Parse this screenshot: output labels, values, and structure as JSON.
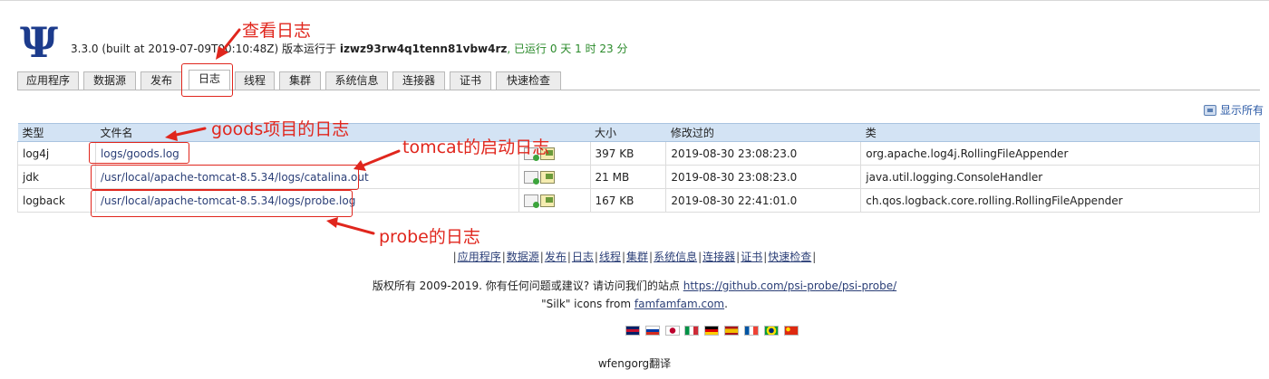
{
  "header": {
    "version": "3.3.0 (built at 2019-07-09T00:10:48Z) 版本运行于",
    "host": "izwz93rw4q1tenn81vbw4rz",
    "uptime": ", 已运行 0 天 1 时 23 分"
  },
  "tabs": [
    {
      "label": "应用程序"
    },
    {
      "label": "数据源"
    },
    {
      "label": "发布"
    },
    {
      "label": "日志"
    },
    {
      "label": "线程"
    },
    {
      "label": "集群"
    },
    {
      "label": "系统信息"
    },
    {
      "label": "连接器"
    },
    {
      "label": "证书"
    },
    {
      "label": "快速检查"
    }
  ],
  "show_all": "显示所有",
  "table": {
    "headers": {
      "type": "类型",
      "file": "文件名",
      "size": "大小",
      "modified": "修改过的",
      "class": "类"
    },
    "rows": [
      {
        "type": "log4j",
        "file": "logs/goods.log",
        "size": "397 KB",
        "modified": "2019-08-30 23:08:23.0",
        "class": "org.apache.log4j.RollingFileAppender"
      },
      {
        "type": "jdk",
        "file": "/usr/local/apache-tomcat-8.5.34/logs/catalina.out",
        "size": "21 MB",
        "modified": "2019-08-30 23:08:23.0",
        "class": "java.util.logging.ConsoleHandler"
      },
      {
        "type": "logback",
        "file": "/usr/local/apache-tomcat-8.5.34/logs/probe.log",
        "size": "167 KB",
        "modified": "2019-08-30 22:41:01.0",
        "class": "ch.qos.logback.core.rolling.RollingFileAppender"
      }
    ]
  },
  "footer": {
    "nav": [
      "应用程序",
      "数据源",
      "发布",
      "日志",
      "线程",
      "集群",
      "系统信息",
      "连接器",
      "证书",
      "快速检查"
    ],
    "copyright_prefix": "版权所有 2009-2019. 你有任何问题或建议? 请访问我们的站点",
    "copyright_link": "https://github.com/psi-probe/psi-probe/",
    "silk_prefix": "\"Silk\" icons from",
    "silk_link": "famfamfam.com",
    "silk_suffix": ".",
    "translator": "wfengorg翻译"
  },
  "annotations": {
    "view_log": "查看日志",
    "goods_log": "goods项目的日志",
    "tomcat_log": "tomcat的启动日志",
    "probe_log": "probe的日志"
  },
  "colors": {
    "annotation": "#e0261d",
    "header_bg": "#d3e3f4",
    "uptime": "#2a8a2a"
  }
}
